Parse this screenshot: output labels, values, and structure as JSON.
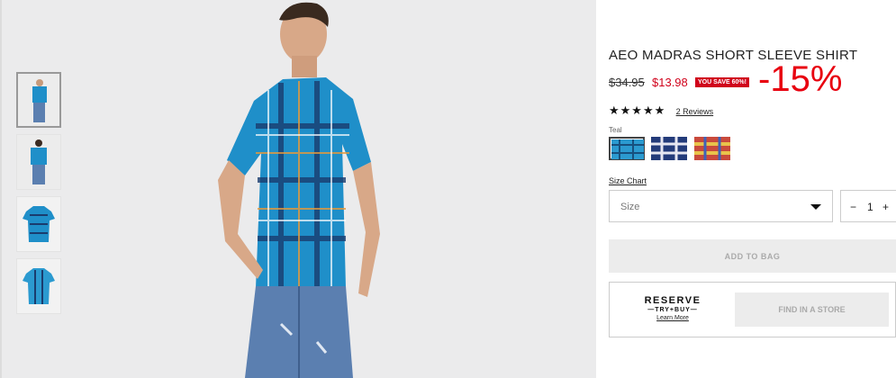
{
  "product": {
    "title": "AEO MADRAS SHORT SLEEVE SHIRT",
    "old_price": "$34.95",
    "new_price": "$13.98",
    "save_badge": "YOU SAVE 60%!",
    "discount_overlay": "-15%",
    "stars": "★★★★★",
    "reviews_link": "2 Reviews",
    "color_label": "Teal",
    "swatches": [
      {
        "name": "Teal",
        "color": "#2b9ad0"
      },
      {
        "name": "Navy",
        "color": "#233b7a"
      },
      {
        "name": "Multi",
        "color": "#c94a3c"
      }
    ]
  },
  "size": {
    "chart_link": "Size Chart",
    "placeholder": "Size"
  },
  "quantity": {
    "minus": "−",
    "value": "1",
    "plus": "+"
  },
  "actions": {
    "add_to_bag": "ADD TO BAG",
    "reserve_line1": "RESERVE",
    "reserve_line2": "—TRY+BUY—",
    "learn_more": "Learn More",
    "find_in_store": "FIND IN A STORE"
  },
  "colors": {
    "sale_red": "#d0021b",
    "shirt_teal": "#1f8fc9",
    "jeans_blue": "#5b7fb0"
  },
  "gallery": {
    "thumbnails": [
      "model-front",
      "model-back",
      "shirt-front",
      "shirt-back"
    ]
  }
}
